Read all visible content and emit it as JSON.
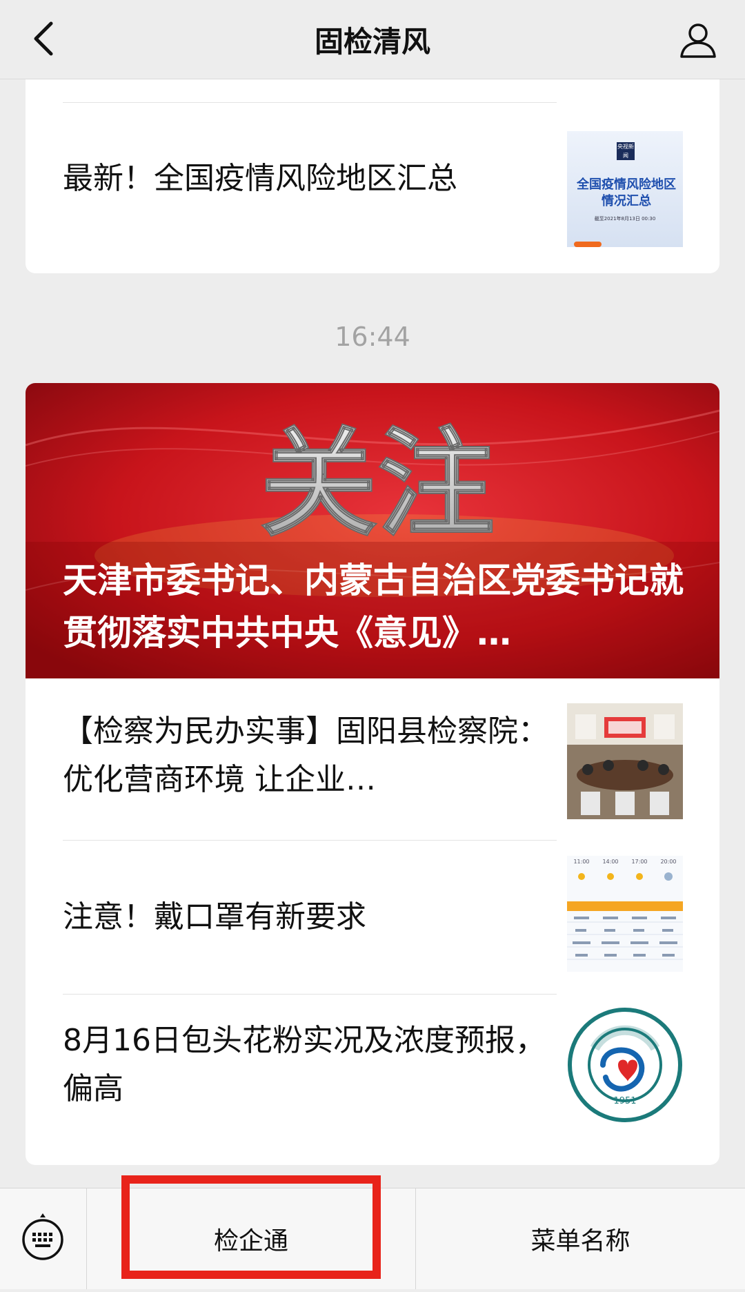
{
  "header": {
    "title": "固检清风"
  },
  "articles_top": [
    {
      "title": "最新！全国疫情风险地区汇总",
      "thumb_text_lines": [
        "全国疫情风险地区",
        "情况汇总"
      ],
      "thumb_badge": "央视新闻",
      "thumb_date": "截至2021年8月13日 00:30"
    }
  ],
  "timestamp": "16:44",
  "hero": {
    "banner_text": "关注",
    "title": "天津市委书记、内蒙古自治区党委书记就贯彻落实中共中央《意见》…"
  },
  "articles": [
    {
      "title": "【检察为民办实事】固阳县检察院：优化营商环境 让企业…"
    },
    {
      "title": "注意！戴口罩有新要求",
      "weather_times": [
        "11:00",
        "14:00",
        "17:00",
        "20:00"
      ]
    },
    {
      "title": "8月16日包头花粉实况及浓度预报，偏高",
      "logo_year": "1951"
    }
  ],
  "bottom_menu": {
    "item1": "检企通",
    "item2": "菜单名称"
  },
  "colors": {
    "accent_red": "#e8231a",
    "hero_red": "#c8141b"
  }
}
